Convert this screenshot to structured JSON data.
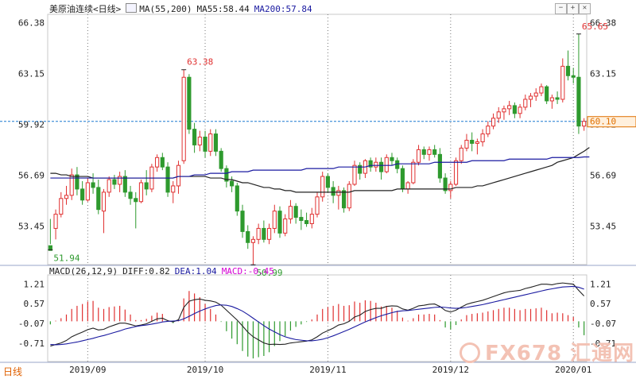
{
  "header": {
    "title": "美原油连续<日线>",
    "ma_indicator": "MA(55,200)",
    "ma55_text": "MA55:58.44",
    "ma200_text": "MA200:57.84"
  },
  "macd_header": {
    "label": "MACD(26,12,9)",
    "diff_text": "DIFF:0.82",
    "dea_text": "DEA:1.04",
    "macd_text": "MACD:-0.45"
  },
  "period_label": "日线",
  "watermark": "FX678 汇通网",
  "toolbar": {
    "minus": "−",
    "plus": "+",
    "close": "✕"
  },
  "colors": {
    "up": "#e03030",
    "down": "#2e9a2e",
    "ma55": "#222222",
    "ma200": "#1a1aa0",
    "dea": "#1a1aa0",
    "dotted": "#1a78d0",
    "macd_tag": "#d400d4",
    "price_tag_bg": "#fff0dd"
  },
  "chart_data": [
    {
      "type": "candlestick",
      "title": "美原油连续<日线>",
      "x_labels": [
        "2019/09",
        "2019/10",
        "2019/11",
        "2019/12",
        "2020/01"
      ],
      "y_ticks": [
        53.45,
        56.69,
        59.92,
        63.15,
        66.38
      ],
      "ylim": [
        51.0,
        66.9
      ],
      "current_price": "60.10",
      "current_price_tick": "59.92",
      "annotations": [
        {
          "label": "51.94",
          "value": 51.94,
          "type": "low"
        },
        {
          "label": "63.38",
          "value": 63.38,
          "type": "high"
        },
        {
          "label": "50.99",
          "value": 50.99,
          "type": "low"
        },
        {
          "label": "65.65",
          "value": 65.65,
          "type": "high"
        }
      ],
      "candles": [
        [
          52.2,
          53.9,
          52.3,
          51.9
        ],
        [
          53.3,
          54.5,
          52.6,
          54.2
        ],
        [
          54.2,
          55.6,
          54.0,
          55.2
        ],
        [
          55.2,
          56.0,
          54.8,
          55.4
        ],
        [
          55.4,
          57.1,
          55.1,
          56.7
        ],
        [
          56.7,
          57.2,
          55.4,
          55.8
        ],
        [
          55.8,
          56.3,
          54.8,
          55.1
        ],
        [
          55.1,
          56.5,
          55.0,
          56.2
        ],
        [
          56.2,
          56.8,
          55.5,
          55.9
        ],
        [
          55.9,
          56.4,
          54.2,
          54.5
        ],
        [
          54.4,
          55.8,
          53.0,
          55.6
        ],
        [
          55.6,
          56.6,
          55.3,
          56.4
        ],
        [
          56.4,
          56.7,
          55.8,
          56.1
        ],
        [
          56.1,
          56.9,
          55.6,
          56.6
        ],
        [
          56.6,
          57.0,
          55.3,
          55.6
        ],
        [
          55.6,
          56.0,
          54.8,
          55.2
        ],
        [
          55.2,
          55.6,
          53.3,
          55.0
        ],
        [
          55.0,
          56.4,
          54.9,
          56.2
        ],
        [
          56.2,
          57.0,
          55.4,
          55.8
        ],
        [
          55.8,
          57.4,
          55.6,
          57.2
        ],
        [
          57.2,
          58.0,
          56.9,
          57.8
        ],
        [
          57.8,
          58.1,
          57.0,
          57.2
        ],
        [
          57.2,
          57.5,
          55.3,
          55.6
        ],
        [
          55.6,
          56.3,
          54.9,
          56.0
        ],
        [
          56.0,
          57.6,
          55.5,
          57.3
        ],
        [
          57.6,
          63.38,
          57.4,
          62.9
        ],
        [
          62.9,
          63.1,
          59.3,
          59.6
        ],
        [
          59.6,
          60.0,
          58.1,
          58.6
        ],
        [
          58.6,
          59.5,
          58.2,
          59.1
        ],
        [
          59.1,
          59.5,
          57.8,
          58.2
        ],
        [
          58.2,
          59.6,
          57.9,
          59.3
        ],
        [
          59.3,
          59.6,
          57.9,
          58.2
        ],
        [
          58.2,
          58.4,
          56.9,
          57.1
        ],
        [
          57.1,
          57.3,
          55.9,
          56.3
        ],
        [
          56.3,
          56.6,
          55.6,
          56.0
        ],
        [
          56.0,
          56.2,
          54.1,
          54.4
        ],
        [
          54.4,
          54.8,
          52.7,
          53.1
        ],
        [
          53.1,
          53.5,
          52.0,
          52.4
        ],
        [
          52.4,
          52.8,
          50.99,
          52.6
        ],
        [
          52.6,
          53.6,
          52.3,
          53.3
        ],
        [
          53.3,
          53.8,
          52.4,
          52.6
        ],
        [
          52.6,
          53.6,
          52.3,
          53.3
        ],
        [
          53.3,
          54.8,
          53.0,
          54.4
        ],
        [
          54.4,
          54.7,
          52.7,
          53.0
        ],
        [
          53.0,
          54.2,
          52.8,
          53.9
        ],
        [
          53.9,
          55.1,
          53.6,
          54.7
        ],
        [
          54.7,
          54.9,
          53.6,
          54.0
        ],
        [
          54.0,
          54.5,
          53.2,
          53.8
        ],
        [
          53.8,
          54.3,
          53.4,
          53.6
        ],
        [
          53.6,
          54.6,
          53.3,
          54.2
        ],
        [
          54.2,
          55.6,
          54.0,
          55.3
        ],
        [
          55.3,
          56.9,
          55.0,
          56.6
        ],
        [
          56.6,
          56.8,
          55.6,
          55.9
        ],
        [
          55.9,
          56.3,
          54.9,
          55.4
        ],
        [
          55.4,
          56.0,
          54.5,
          55.7
        ],
        [
          55.7,
          55.9,
          54.3,
          54.6
        ],
        [
          54.6,
          56.3,
          54.4,
          56.1
        ],
        [
          56.1,
          57.6,
          56.0,
          57.3
        ],
        [
          57.3,
          57.5,
          56.4,
          56.8
        ],
        [
          56.8,
          57.7,
          56.5,
          57.6
        ],
        [
          57.6,
          57.8,
          56.9,
          57.2
        ],
        [
          57.2,
          57.8,
          56.9,
          57.5
        ],
        [
          57.5,
          57.8,
          56.4,
          56.9
        ],
        [
          56.9,
          58.0,
          56.8,
          57.8
        ],
        [
          57.8,
          58.1,
          57.3,
          57.6
        ],
        [
          57.6,
          57.8,
          56.8,
          57.1
        ],
        [
          57.1,
          57.3,
          55.6,
          55.8
        ],
        [
          55.8,
          56.3,
          55.5,
          56.2
        ],
        [
          56.2,
          57.7,
          56.1,
          57.5
        ],
        [
          57.5,
          58.6,
          57.3,
          58.3
        ],
        [
          58.3,
          58.5,
          57.7,
          58.0
        ],
        [
          58.0,
          58.5,
          57.6,
          58.3
        ],
        [
          58.3,
          58.6,
          57.8,
          58.0
        ],
        [
          58.0,
          58.4,
          56.2,
          56.5
        ],
        [
          56.5,
          56.8,
          55.5,
          55.7
        ],
        [
          55.7,
          56.3,
          55.2,
          56.1
        ],
        [
          56.1,
          57.8,
          56.0,
          57.6
        ],
        [
          57.6,
          58.6,
          57.4,
          58.4
        ],
        [
          58.4,
          59.3,
          58.2,
          58.9
        ],
        [
          58.9,
          59.4,
          58.2,
          58.7
        ],
        [
          58.7,
          59.0,
          58.0,
          58.8
        ],
        [
          58.8,
          59.6,
          58.5,
          59.3
        ],
        [
          59.3,
          60.1,
          59.1,
          59.8
        ],
        [
          59.8,
          60.6,
          59.6,
          60.3
        ],
        [
          60.3,
          61.0,
          60.0,
          60.7
        ],
        [
          60.7,
          61.1,
          60.2,
          60.9
        ],
        [
          60.9,
          61.4,
          60.5,
          61.1
        ],
        [
          61.1,
          61.3,
          60.3,
          60.6
        ],
        [
          60.6,
          61.2,
          60.3,
          61.0
        ],
        [
          61.0,
          61.8,
          60.8,
          61.5
        ],
        [
          61.5,
          61.9,
          61.0,
          61.7
        ],
        [
          61.7,
          62.2,
          61.4,
          61.9
        ],
        [
          61.9,
          62.5,
          61.7,
          62.3
        ],
        [
          62.3,
          62.4,
          61.2,
          61.4
        ],
        [
          61.4,
          61.8,
          60.9,
          61.6
        ],
        [
          61.6,
          62.0,
          61.2,
          61.5
        ],
        [
          61.5,
          64.1,
          61.3,
          63.6
        ],
        [
          63.6,
          64.6,
          62.7,
          63.0
        ],
        [
          63.0,
          63.5,
          62.5,
          62.9
        ],
        [
          62.9,
          65.65,
          59.3,
          59.8
        ],
        [
          59.8,
          60.3,
          59.5,
          60.1
        ]
      ],
      "series": [
        {
          "name": "MA55",
          "values": [
            56.8,
            56.8,
            56.7,
            56.7,
            56.6,
            56.6,
            56.6,
            56.6,
            56.5,
            56.5,
            56.5,
            56.5,
            56.5,
            56.5,
            56.5,
            56.5,
            56.5,
            56.5,
            56.5,
            56.5,
            56.5,
            56.5,
            56.5,
            56.5,
            56.6,
            56.6,
            56.6,
            56.6,
            56.6,
            56.6,
            56.5,
            56.5,
            56.5,
            56.4,
            56.4,
            56.3,
            56.2,
            56.2,
            56.1,
            56.0,
            55.9,
            55.9,
            55.8,
            55.8,
            55.7,
            55.7,
            55.6,
            55.6,
            55.6,
            55.6,
            55.6,
            55.6,
            55.6,
            55.6,
            55.6,
            55.6,
            55.6,
            55.7,
            55.7,
            55.7,
            55.7,
            55.7,
            55.7,
            55.7,
            55.7,
            55.8,
            55.8,
            55.8,
            55.8,
            55.8,
            55.8,
            55.8,
            55.8,
            55.8,
            55.8,
            55.8,
            55.9,
            55.9,
            55.9,
            55.9,
            56.0,
            56.0,
            56.1,
            56.2,
            56.3,
            56.4,
            56.5,
            56.6,
            56.7,
            56.8,
            56.9,
            57.0,
            57.1,
            57.2,
            57.3,
            57.5,
            57.6,
            57.7,
            57.8,
            58.0,
            58.2,
            58.44
          ]
        },
        {
          "name": "MA200",
          "values": [
            56.5,
            56.5,
            56.5,
            56.5,
            56.5,
            56.5,
            56.5,
            56.5,
            56.5,
            56.5,
            56.5,
            56.5,
            56.5,
            56.5,
            56.5,
            56.5,
            56.5,
            56.5,
            56.5,
            56.5,
            56.5,
            56.5,
            56.5,
            56.5,
            56.6,
            56.6,
            56.6,
            56.7,
            56.7,
            56.7,
            56.8,
            56.8,
            56.8,
            56.8,
            56.9,
            56.9,
            56.9,
            56.9,
            57.0,
            57.0,
            57.0,
            57.0,
            57.0,
            57.0,
            57.0,
            57.0,
            57.0,
            57.0,
            57.1,
            57.1,
            57.1,
            57.1,
            57.1,
            57.1,
            57.2,
            57.2,
            57.2,
            57.2,
            57.2,
            57.2,
            57.3,
            57.3,
            57.3,
            57.3,
            57.3,
            57.4,
            57.4,
            57.4,
            57.4,
            57.4,
            57.4,
            57.4,
            57.5,
            57.5,
            57.5,
            57.5,
            57.5,
            57.5,
            57.5,
            57.6,
            57.6,
            57.6,
            57.6,
            57.6,
            57.6,
            57.6,
            57.7,
            57.7,
            57.7,
            57.7,
            57.7,
            57.7,
            57.7,
            57.7,
            57.8,
            57.8,
            57.8,
            57.8,
            57.8,
            57.8,
            57.84,
            57.84
          ]
        }
      ]
    },
    {
      "type": "macd",
      "title": "MACD(26,12,9)",
      "y_ticks": [
        -0.71,
        -0.07,
        0.57,
        1.21
      ],
      "ylim": [
        -1.3,
        1.5
      ],
      "series": [
        {
          "name": "DIFF",
          "values": [
            -0.8,
            -0.75,
            -0.7,
            -0.62,
            -0.5,
            -0.42,
            -0.35,
            -0.27,
            -0.22,
            -0.28,
            -0.26,
            -0.18,
            -0.12,
            -0.06,
            -0.06,
            -0.1,
            -0.15,
            -0.12,
            -0.08,
            0.0,
            0.08,
            0.1,
            0.02,
            -0.02,
            0.05,
            0.45,
            0.65,
            0.7,
            0.72,
            0.68,
            0.66,
            0.62,
            0.52,
            0.36,
            0.2,
            0.04,
            -0.15,
            -0.35,
            -0.5,
            -0.6,
            -0.7,
            -0.75,
            -0.74,
            -0.75,
            -0.74,
            -0.7,
            -0.68,
            -0.66,
            -0.64,
            -0.6,
            -0.5,
            -0.38,
            -0.3,
            -0.22,
            -0.12,
            -0.08,
            0.0,
            0.14,
            0.2,
            0.32,
            0.38,
            0.42,
            0.42,
            0.48,
            0.5,
            0.49,
            0.4,
            0.36,
            0.42,
            0.5,
            0.52,
            0.55,
            0.56,
            0.48,
            0.35,
            0.3,
            0.36,
            0.46,
            0.55,
            0.6,
            0.64,
            0.68,
            0.74,
            0.8,
            0.86,
            0.92,
            0.96,
            0.98,
            1.0,
            1.06,
            1.1,
            1.15,
            1.2,
            1.2,
            1.18,
            1.22,
            1.24,
            1.22,
            1.2,
            1.0,
            0.82
          ]
        },
        {
          "name": "DEA",
          "values": [
            -0.75,
            -0.76,
            -0.75,
            -0.73,
            -0.7,
            -0.67,
            -0.63,
            -0.59,
            -0.55,
            -0.5,
            -0.46,
            -0.41,
            -0.36,
            -0.31,
            -0.25,
            -0.21,
            -0.17,
            -0.14,
            -0.12,
            -0.09,
            -0.06,
            -0.02,
            0.0,
            0.01,
            0.02,
            0.08,
            0.16,
            0.25,
            0.33,
            0.4,
            0.46,
            0.51,
            0.53,
            0.52,
            0.48,
            0.41,
            0.33,
            0.22,
            0.1,
            -0.02,
            -0.14,
            -0.25,
            -0.34,
            -0.43,
            -0.5,
            -0.55,
            -0.59,
            -0.61,
            -0.63,
            -0.63,
            -0.61,
            -0.58,
            -0.53,
            -0.47,
            -0.4,
            -0.33,
            -0.26,
            -0.18,
            -0.1,
            -0.02,
            0.05,
            0.12,
            0.18,
            0.23,
            0.28,
            0.32,
            0.34,
            0.35,
            0.37,
            0.39,
            0.41,
            0.43,
            0.45,
            0.46,
            0.45,
            0.43,
            0.42,
            0.43,
            0.45,
            0.48,
            0.51,
            0.54,
            0.58,
            0.62,
            0.66,
            0.7,
            0.74,
            0.78,
            0.82,
            0.86,
            0.9,
            0.94,
            0.98,
            1.02,
            1.05,
            1.08,
            1.11,
            1.12,
            1.13,
            1.1,
            1.04
          ]
        },
        {
          "name": "MACD",
          "values": [
            -0.1,
            0.02,
            0.1,
            0.22,
            0.4,
            0.5,
            0.56,
            0.64,
            0.66,
            0.44,
            0.4,
            0.46,
            0.48,
            0.5,
            0.38,
            0.22,
            0.04,
            0.04,
            0.08,
            0.18,
            0.28,
            0.24,
            0.04,
            -0.06,
            0.06,
            0.74,
            0.98,
            0.9,
            0.78,
            0.56,
            0.4,
            0.22,
            -0.02,
            -0.32,
            -0.56,
            -0.74,
            -0.96,
            -1.14,
            -1.2,
            -1.16,
            -1.12,
            -1.0,
            -0.8,
            -0.64,
            -0.48,
            -0.3,
            -0.18,
            -0.1,
            -0.02,
            0.06,
            0.22,
            0.4,
            0.46,
            0.5,
            0.56,
            0.5,
            0.52,
            0.64,
            0.6,
            0.68,
            0.66,
            0.6,
            0.48,
            0.5,
            0.44,
            0.34,
            0.12,
            0.02,
            0.1,
            0.22,
            0.22,
            0.24,
            0.22,
            0.04,
            -0.2,
            -0.26,
            -0.12,
            0.06,
            0.2,
            0.24,
            0.26,
            0.28,
            0.32,
            0.36,
            0.4,
            0.44,
            0.44,
            0.4,
            0.36,
            0.4,
            0.4,
            0.42,
            0.44,
            0.36,
            0.26,
            0.28,
            0.26,
            0.2,
            0.14,
            -0.2,
            -0.45
          ]
        }
      ]
    }
  ]
}
